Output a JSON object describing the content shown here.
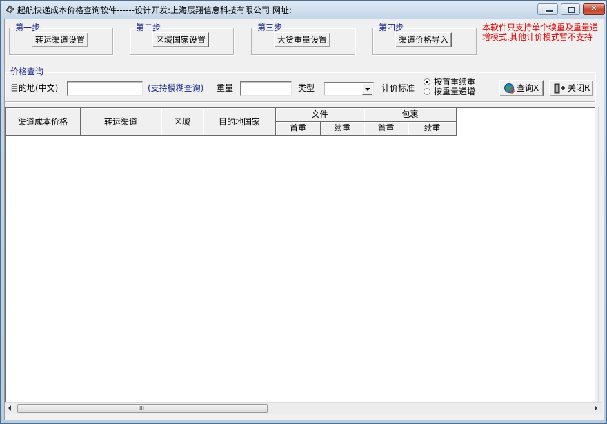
{
  "window": {
    "title": "起航快递成本价格查询软件------设计开发:上海辰翔信息科技有限公司 网址:",
    "controls": {
      "minimize": "minimize",
      "maximize": "maximize",
      "close": "✕"
    }
  },
  "steps": [
    {
      "label": "第一步",
      "button": "转运渠道设置"
    },
    {
      "label": "第二步",
      "button": "区域国家设置"
    },
    {
      "label": "第三步",
      "button": "大货重量设置"
    },
    {
      "label": "第四步",
      "button": "渠道价格导入"
    }
  ],
  "notice": "本软件只支持单个续重及重量递增模式,其他计价模式暂不支持",
  "query": {
    "group_label": "价格查询",
    "destination_label": "目的地(中文)",
    "destination_value": "",
    "fuzzy_hint": "(支持模糊查询)",
    "weight_label": "重量",
    "weight_value": "",
    "type_label": "类型",
    "type_value": "",
    "pricing_label": "计价标准",
    "pricing_options": [
      {
        "label": "按首重续重",
        "checked": true
      },
      {
        "label": "按重量递增",
        "checked": false
      }
    ],
    "query_button": "查询X",
    "close_button": "关闭R"
  },
  "table": {
    "columns": [
      "渠道成本价格",
      "转运渠道",
      "区域",
      "目的地国家"
    ],
    "groups": [
      {
        "label": "文件",
        "sub": [
          "首重",
          "续重"
        ]
      },
      {
        "label": "包裹",
        "sub": [
          "首重",
          "续重"
        ]
      }
    ],
    "rows": []
  },
  "scrollbar": {
    "grip": "III"
  }
}
